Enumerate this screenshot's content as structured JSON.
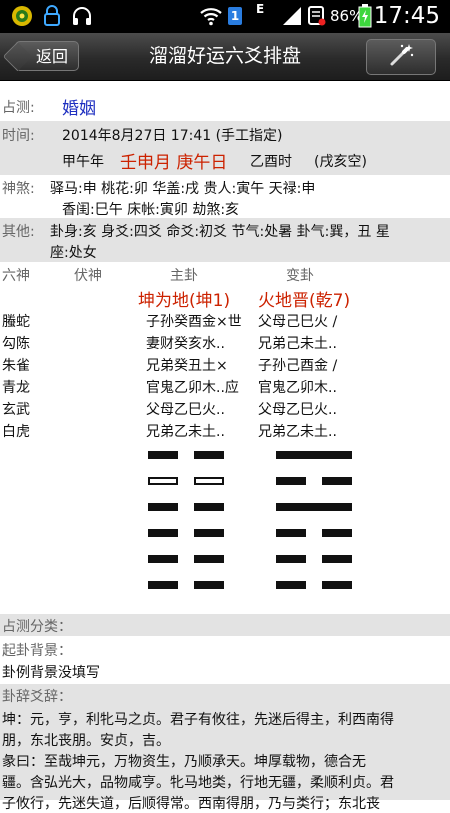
{
  "status_bar": {
    "time": "17:45",
    "battery": "86%",
    "network": "E",
    "sim_badge": "1",
    "icons": [
      "app-icon",
      "lock-icon",
      "headphones-icon",
      "wifi-icon",
      "sim-icon",
      "signal-icon",
      "sms-icon",
      "battery-icon"
    ]
  },
  "header": {
    "back_label": "返回",
    "title": "溜溜好运六爻排盘",
    "action_icon": "magic-wand-icon"
  },
  "divination": {
    "topic_label": "占测:",
    "topic_value": "婚姻",
    "time_label": "时间:",
    "time_value": "2014年8月27日 17:41 (手工指定)",
    "ganzhi_year": "甲午年",
    "ganzhi_month_day": "壬申月 庚午日",
    "ganzhi_hour": "乙酉时",
    "kongwang": "(戌亥空)",
    "shensha_label": "神煞:",
    "shensha_line1": "驿马:申 桃花:卯 华盖:戌 贵人:寅午 天禄:申",
    "shensha_line2": "香闺:巳午 床帐:寅卯 劫煞:亥",
    "other_label": "其他:",
    "other_line1": "卦身:亥 身爻:四爻 命爻:初爻 节气:处暑 卦气:巽，丑 星",
    "other_line2": "座:处女"
  },
  "table": {
    "headers": [
      "六神",
      "伏神",
      "主卦",
      "变卦"
    ],
    "main_gua_name": "坤为地(坤1)",
    "changed_gua_name": "火地晋(乾7)",
    "rows": [
      {
        "liushen": "螣蛇",
        "main": "子孙癸酉金×世",
        "changed": "父母己巳火 /"
      },
      {
        "liushen": "勾陈",
        "main": "妻财癸亥水..",
        "changed": "兄弟己未土.."
      },
      {
        "liushen": "朱雀",
        "main": "兄弟癸丑土×",
        "changed": "子孙己酉金 /"
      },
      {
        "liushen": "青龙",
        "main": "官鬼乙卯木..应",
        "changed": "官鬼乙卯木.."
      },
      {
        "liushen": "玄武",
        "main": "父母乙巳火..",
        "changed": "父母乙巳火.."
      },
      {
        "liushen": "白虎",
        "main": "兄弟乙未土..",
        "changed": "兄弟乙未土.."
      }
    ]
  },
  "hexagram": {
    "main_lines": [
      "yin",
      "yin-moving",
      "yin",
      "yin",
      "yin",
      "yin"
    ],
    "changed_lines": [
      "yang",
      "yin",
      "yang",
      "yin",
      "yin",
      "yin"
    ]
  },
  "sections": {
    "category_label": "占测分类：",
    "background_label": "起卦背景：",
    "background_value": "卦例背景没填写",
    "guaci_label": "卦辞爻辞：",
    "guaci_p1_l1": "坤：元，亨，利牝马之贞。君子有攸往，先迷后得主，利西南得",
    "guaci_p1_l2": "朋，东北丧朋。安贞，吉。",
    "guaci_p2_l1": "彖曰：至哉坤元，万物资生，乃顺承天。坤厚载物，德合无",
    "guaci_p2_l2": "疆。含弘光大，品物咸亨。牝马地类，行地无疆，柔顺利贞。君",
    "guaci_p2_l3": "子攸行，先迷失道，后顺得常。西南得朋，乃与类行；东北丧"
  },
  "colors": {
    "accent_red": "#cc2200",
    "accent_blue": "#1e2fc0",
    "section_gray": "#e3e3e3"
  }
}
